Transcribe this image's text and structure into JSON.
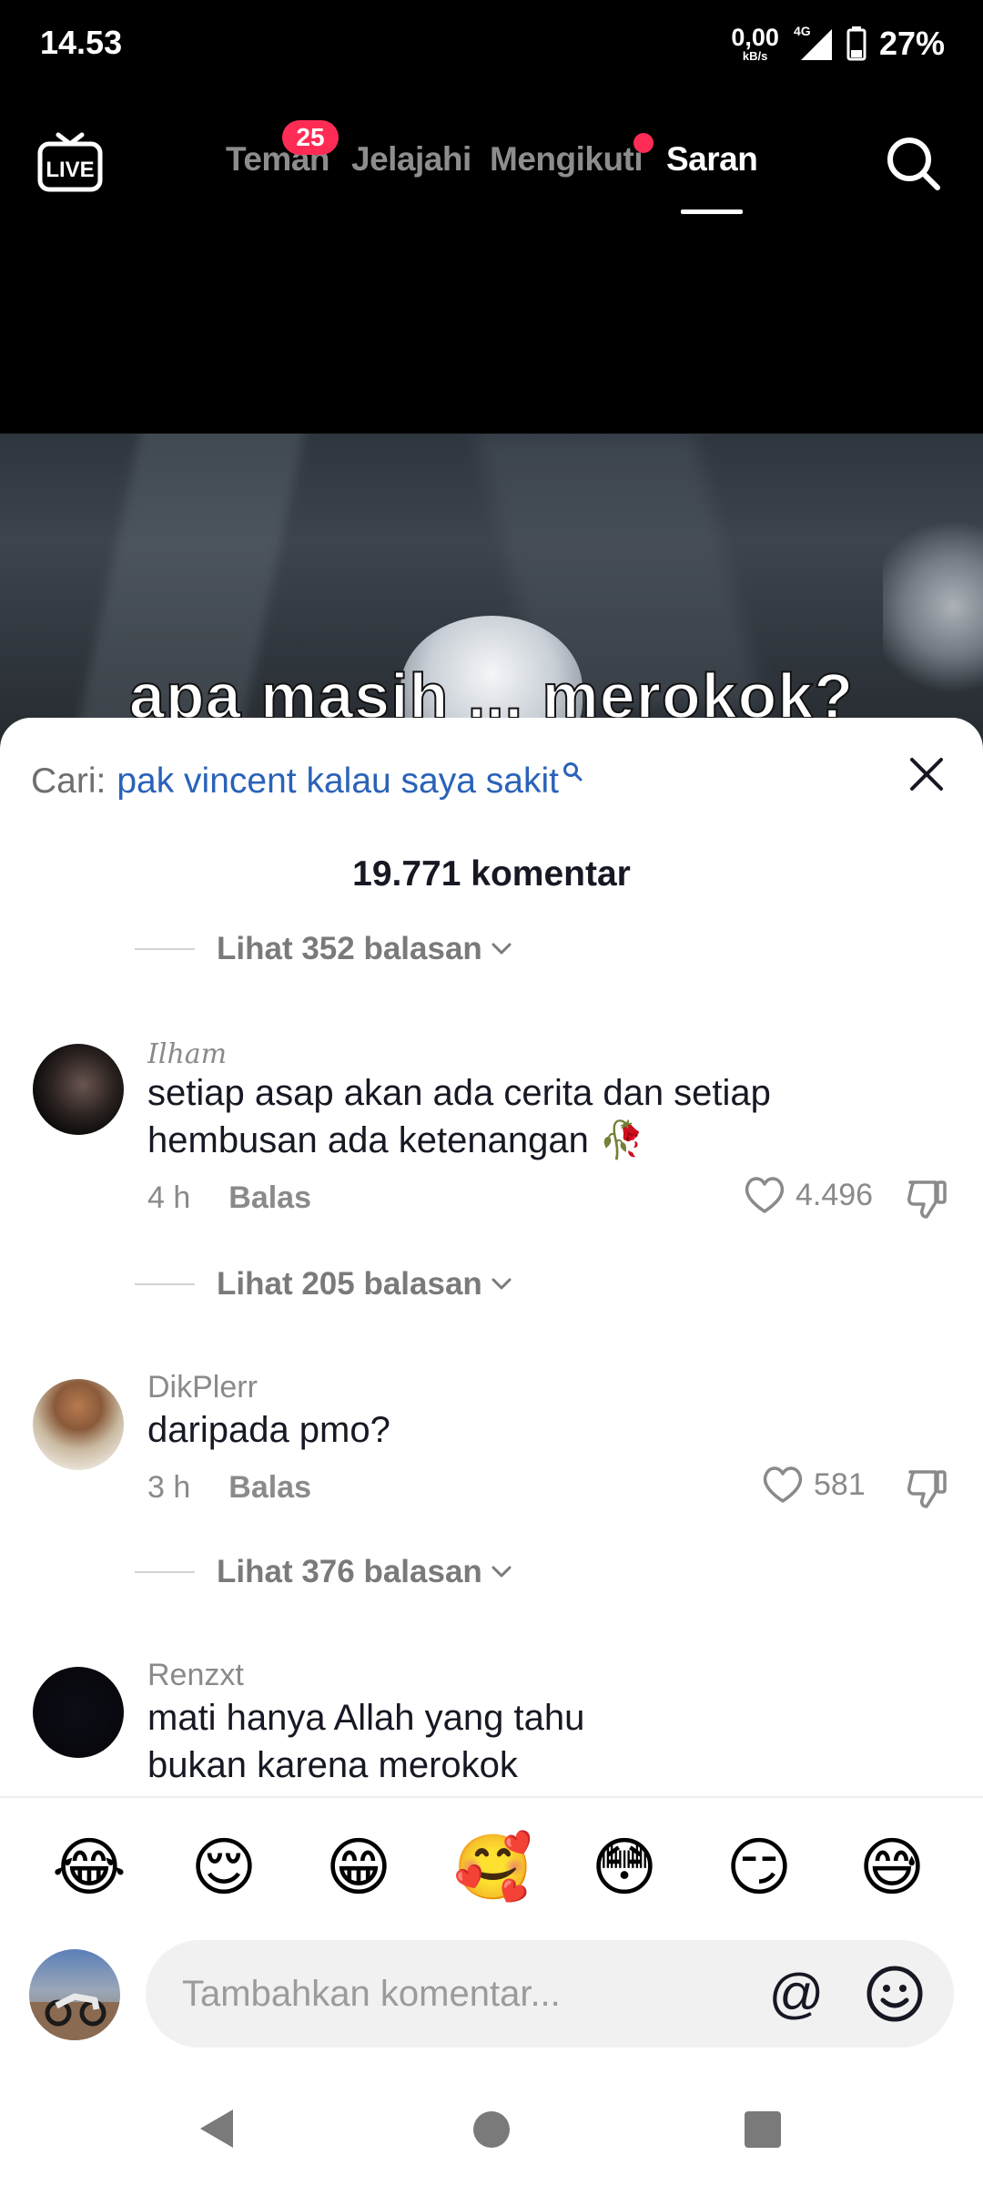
{
  "status_bar": {
    "time": "14.53",
    "net_speed": "0,00",
    "net_unit": "kB/s",
    "network_type": "4G",
    "battery": "27%"
  },
  "top_nav": {
    "tabs": [
      {
        "label": "Teman",
        "badge": "25"
      },
      {
        "label": "Jelajahi"
      },
      {
        "label": "Mengikuti",
        "dot": true
      },
      {
        "label": "Saran",
        "active": true
      }
    ]
  },
  "video": {
    "overlay_text": "apa masih ... merokok?"
  },
  "comments_sheet": {
    "search_prefix": "Cari:",
    "search_term": "pak vincent kalau saya sakit",
    "count_label": "19.771 komentar",
    "top_view_replies": "Lihat 352 balasan",
    "comments": [
      {
        "username": "Ilham",
        "text": "setiap asap akan ada cerita dan setiap hembusan ada ketenangan 🥀",
        "time": "4 h",
        "reply_label": "Balas",
        "likes": "4.496",
        "view_replies": "Lihat 205 balasan"
      },
      {
        "username": "DikPlerr",
        "text": "daripada pmo?",
        "time": "3 h",
        "reply_label": "Balas",
        "likes": "581",
        "view_replies": "Lihat 376 balasan"
      },
      {
        "username": "Renzxt",
        "text": "mati hanya Allah yang tahu\nbukan karena merokok"
      }
    ]
  },
  "emoji_bar": [
    "😂",
    "😌",
    "😁",
    "🥰",
    "😳",
    "😏",
    "😅"
  ],
  "composer": {
    "placeholder": "Tambahkan komentar...",
    "mention_symbol": "@"
  },
  "icons": {
    "live": "live-tv-icon",
    "search": "search-icon",
    "close": "close-icon",
    "like": "heart-outline-icon",
    "dislike": "thumbs-down-icon",
    "emoji_picker": "smiley-icon"
  },
  "colors": {
    "accent": "#fe2c55",
    "link": "#2a62b8"
  }
}
